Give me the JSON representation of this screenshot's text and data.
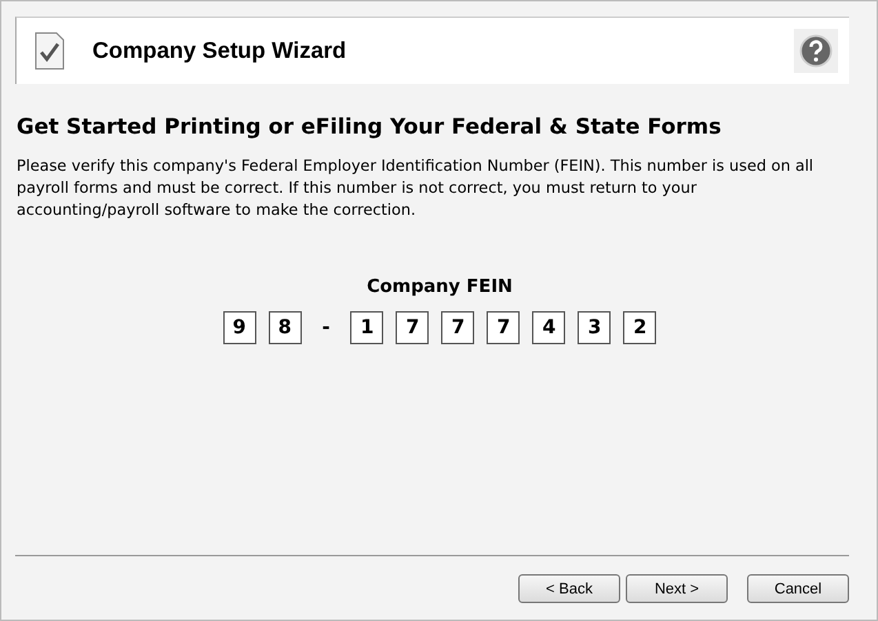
{
  "header": {
    "title": "Company Setup Wizard"
  },
  "heading": "Get Started Printing or eFiling Your Federal & State Forms",
  "description": "Please verify this company's Federal Employer Identification Number (FEIN). This number is used on all payroll forms and must be correct. If this number is not correct, you must return to your accounting/payroll software to make the correction.",
  "fein": {
    "label": "Company FEIN",
    "characters": [
      {
        "kind": "digit",
        "text": "9"
      },
      {
        "kind": "digit",
        "text": "8"
      },
      {
        "kind": "separator",
        "text": "-"
      },
      {
        "kind": "digit",
        "text": "1"
      },
      {
        "kind": "digit",
        "text": "7"
      },
      {
        "kind": "digit",
        "text": "7"
      },
      {
        "kind": "digit",
        "text": "7"
      },
      {
        "kind": "digit",
        "text": "4"
      },
      {
        "kind": "digit",
        "text": "3"
      },
      {
        "kind": "digit",
        "text": "2"
      }
    ]
  },
  "buttons": [
    {
      "label": "< Back",
      "kind": "nav"
    },
    {
      "label": "Next >",
      "kind": "nav"
    },
    {
      "label": "Cancel",
      "kind": "cancel"
    }
  ]
}
